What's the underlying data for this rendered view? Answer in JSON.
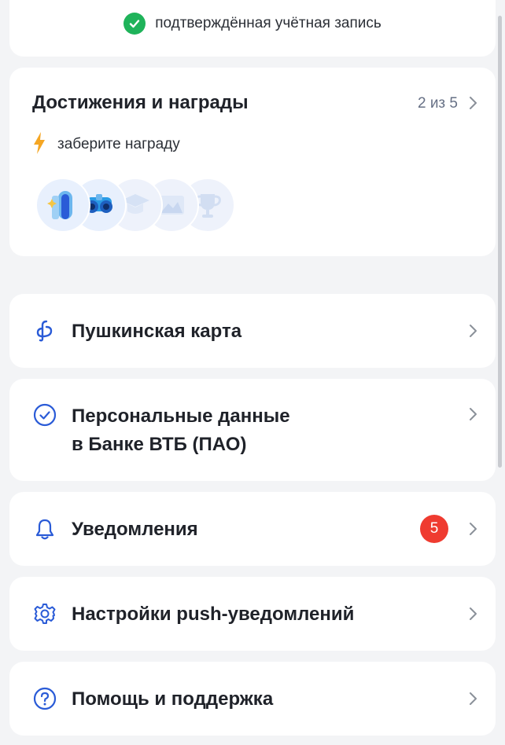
{
  "verified": {
    "text": "подтверждённая учётная запись"
  },
  "achievements": {
    "title": "Достижения и награды",
    "count": "2 из 5",
    "reward_text": "заберите награду",
    "badges": [
      "door-badge-icon",
      "binoculars-badge-icon",
      "graduation-cap-badge-icon",
      "landscape-badge-icon",
      "trophy-badge-icon"
    ]
  },
  "menu": {
    "pushkin_card": {
      "label": "Пушкинская карта",
      "icon": "pushkin-card-icon"
    },
    "personal_data": {
      "line1": "Персональные данные",
      "line2": "в Банке ВТБ (ПАО)",
      "icon": "check-circle-icon"
    },
    "notifications": {
      "label": "Уведомления",
      "badge": "5",
      "icon": "bell-icon"
    },
    "push_settings": {
      "label": "Настройки push-уведомлений",
      "icon": "gear-icon"
    },
    "help": {
      "label": "Помощь и поддержка",
      "icon": "question-icon"
    }
  },
  "colors": {
    "accent": "#2a5bd7",
    "success": "#1fb35a",
    "alert": "#ef3b30",
    "lightning": "#f5a623"
  }
}
